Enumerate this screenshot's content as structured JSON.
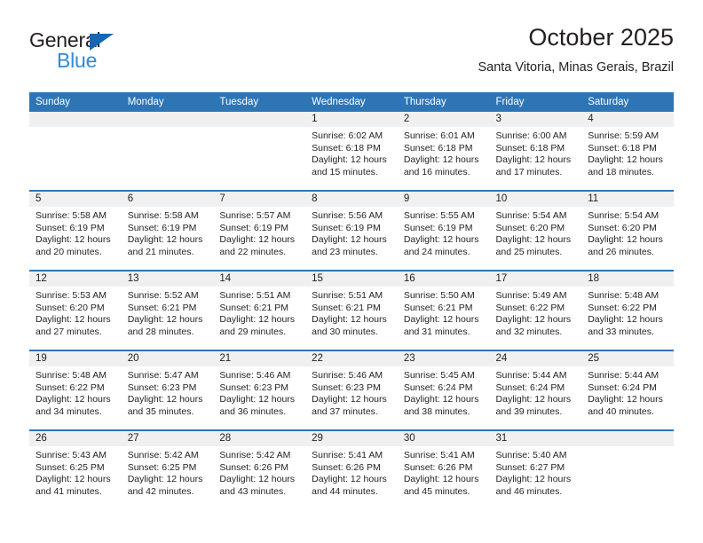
{
  "brand": {
    "name_part1": "General",
    "name_part2": "Blue",
    "triangle_icon": "triangle-icon",
    "colors": {
      "dark": "#231f20",
      "blue": "#2e8bd8",
      "triangle": "#1667b3"
    }
  },
  "header": {
    "month_title": "October 2025",
    "location": "Santa Vitoria, Minas Gerais, Brazil"
  },
  "theme": {
    "header_blue": "#2e75b6",
    "daynum_band": "#f0f0f0",
    "cell_background": "#ffffff",
    "text": "#231f20"
  },
  "calendar": {
    "weekday_headers": [
      "Sunday",
      "Monday",
      "Tuesday",
      "Wednesday",
      "Thursday",
      "Friday",
      "Saturday"
    ],
    "weeks": [
      [
        {
          "day": "",
          "empty": true,
          "sunrise": "",
          "sunset": "",
          "daylight_line1": "",
          "daylight_line2": ""
        },
        {
          "day": "",
          "empty": true,
          "sunrise": "",
          "sunset": "",
          "daylight_line1": "",
          "daylight_line2": ""
        },
        {
          "day": "",
          "empty": true,
          "sunrise": "",
          "sunset": "",
          "daylight_line1": "",
          "daylight_line2": ""
        },
        {
          "day": "1",
          "empty": false,
          "sunrise": "Sunrise: 6:02 AM",
          "sunset": "Sunset: 6:18 PM",
          "daylight_line1": "Daylight: 12 hours",
          "daylight_line2": "and 15 minutes."
        },
        {
          "day": "2",
          "empty": false,
          "sunrise": "Sunrise: 6:01 AM",
          "sunset": "Sunset: 6:18 PM",
          "daylight_line1": "Daylight: 12 hours",
          "daylight_line2": "and 16 minutes."
        },
        {
          "day": "3",
          "empty": false,
          "sunrise": "Sunrise: 6:00 AM",
          "sunset": "Sunset: 6:18 PM",
          "daylight_line1": "Daylight: 12 hours",
          "daylight_line2": "and 17 minutes."
        },
        {
          "day": "4",
          "empty": false,
          "sunrise": "Sunrise: 5:59 AM",
          "sunset": "Sunset: 6:18 PM",
          "daylight_line1": "Daylight: 12 hours",
          "daylight_line2": "and 18 minutes."
        }
      ],
      [
        {
          "day": "5",
          "empty": false,
          "sunrise": "Sunrise: 5:58 AM",
          "sunset": "Sunset: 6:19 PM",
          "daylight_line1": "Daylight: 12 hours",
          "daylight_line2": "and 20 minutes."
        },
        {
          "day": "6",
          "empty": false,
          "sunrise": "Sunrise: 5:58 AM",
          "sunset": "Sunset: 6:19 PM",
          "daylight_line1": "Daylight: 12 hours",
          "daylight_line2": "and 21 minutes."
        },
        {
          "day": "7",
          "empty": false,
          "sunrise": "Sunrise: 5:57 AM",
          "sunset": "Sunset: 6:19 PM",
          "daylight_line1": "Daylight: 12 hours",
          "daylight_line2": "and 22 minutes."
        },
        {
          "day": "8",
          "empty": false,
          "sunrise": "Sunrise: 5:56 AM",
          "sunset": "Sunset: 6:19 PM",
          "daylight_line1": "Daylight: 12 hours",
          "daylight_line2": "and 23 minutes."
        },
        {
          "day": "9",
          "empty": false,
          "sunrise": "Sunrise: 5:55 AM",
          "sunset": "Sunset: 6:19 PM",
          "daylight_line1": "Daylight: 12 hours",
          "daylight_line2": "and 24 minutes."
        },
        {
          "day": "10",
          "empty": false,
          "sunrise": "Sunrise: 5:54 AM",
          "sunset": "Sunset: 6:20 PM",
          "daylight_line1": "Daylight: 12 hours",
          "daylight_line2": "and 25 minutes."
        },
        {
          "day": "11",
          "empty": false,
          "sunrise": "Sunrise: 5:54 AM",
          "sunset": "Sunset: 6:20 PM",
          "daylight_line1": "Daylight: 12 hours",
          "daylight_line2": "and 26 minutes."
        }
      ],
      [
        {
          "day": "12",
          "empty": false,
          "sunrise": "Sunrise: 5:53 AM",
          "sunset": "Sunset: 6:20 PM",
          "daylight_line1": "Daylight: 12 hours",
          "daylight_line2": "and 27 minutes."
        },
        {
          "day": "13",
          "empty": false,
          "sunrise": "Sunrise: 5:52 AM",
          "sunset": "Sunset: 6:21 PM",
          "daylight_line1": "Daylight: 12 hours",
          "daylight_line2": "and 28 minutes."
        },
        {
          "day": "14",
          "empty": false,
          "sunrise": "Sunrise: 5:51 AM",
          "sunset": "Sunset: 6:21 PM",
          "daylight_line1": "Daylight: 12 hours",
          "daylight_line2": "and 29 minutes."
        },
        {
          "day": "15",
          "empty": false,
          "sunrise": "Sunrise: 5:51 AM",
          "sunset": "Sunset: 6:21 PM",
          "daylight_line1": "Daylight: 12 hours",
          "daylight_line2": "and 30 minutes."
        },
        {
          "day": "16",
          "empty": false,
          "sunrise": "Sunrise: 5:50 AM",
          "sunset": "Sunset: 6:21 PM",
          "daylight_line1": "Daylight: 12 hours",
          "daylight_line2": "and 31 minutes."
        },
        {
          "day": "17",
          "empty": false,
          "sunrise": "Sunrise: 5:49 AM",
          "sunset": "Sunset: 6:22 PM",
          "daylight_line1": "Daylight: 12 hours",
          "daylight_line2": "and 32 minutes."
        },
        {
          "day": "18",
          "empty": false,
          "sunrise": "Sunrise: 5:48 AM",
          "sunset": "Sunset: 6:22 PM",
          "daylight_line1": "Daylight: 12 hours",
          "daylight_line2": "and 33 minutes."
        }
      ],
      [
        {
          "day": "19",
          "empty": false,
          "sunrise": "Sunrise: 5:48 AM",
          "sunset": "Sunset: 6:22 PM",
          "daylight_line1": "Daylight: 12 hours",
          "daylight_line2": "and 34 minutes."
        },
        {
          "day": "20",
          "empty": false,
          "sunrise": "Sunrise: 5:47 AM",
          "sunset": "Sunset: 6:23 PM",
          "daylight_line1": "Daylight: 12 hours",
          "daylight_line2": "and 35 minutes."
        },
        {
          "day": "21",
          "empty": false,
          "sunrise": "Sunrise: 5:46 AM",
          "sunset": "Sunset: 6:23 PM",
          "daylight_line1": "Daylight: 12 hours",
          "daylight_line2": "and 36 minutes."
        },
        {
          "day": "22",
          "empty": false,
          "sunrise": "Sunrise: 5:46 AM",
          "sunset": "Sunset: 6:23 PM",
          "daylight_line1": "Daylight: 12 hours",
          "daylight_line2": "and 37 minutes."
        },
        {
          "day": "23",
          "empty": false,
          "sunrise": "Sunrise: 5:45 AM",
          "sunset": "Sunset: 6:24 PM",
          "daylight_line1": "Daylight: 12 hours",
          "daylight_line2": "and 38 minutes."
        },
        {
          "day": "24",
          "empty": false,
          "sunrise": "Sunrise: 5:44 AM",
          "sunset": "Sunset: 6:24 PM",
          "daylight_line1": "Daylight: 12 hours",
          "daylight_line2": "and 39 minutes."
        },
        {
          "day": "25",
          "empty": false,
          "sunrise": "Sunrise: 5:44 AM",
          "sunset": "Sunset: 6:24 PM",
          "daylight_line1": "Daylight: 12 hours",
          "daylight_line2": "and 40 minutes."
        }
      ],
      [
        {
          "day": "26",
          "empty": false,
          "sunrise": "Sunrise: 5:43 AM",
          "sunset": "Sunset: 6:25 PM",
          "daylight_line1": "Daylight: 12 hours",
          "daylight_line2": "and 41 minutes."
        },
        {
          "day": "27",
          "empty": false,
          "sunrise": "Sunrise: 5:42 AM",
          "sunset": "Sunset: 6:25 PM",
          "daylight_line1": "Daylight: 12 hours",
          "daylight_line2": "and 42 minutes."
        },
        {
          "day": "28",
          "empty": false,
          "sunrise": "Sunrise: 5:42 AM",
          "sunset": "Sunset: 6:26 PM",
          "daylight_line1": "Daylight: 12 hours",
          "daylight_line2": "and 43 minutes."
        },
        {
          "day": "29",
          "empty": false,
          "sunrise": "Sunrise: 5:41 AM",
          "sunset": "Sunset: 6:26 PM",
          "daylight_line1": "Daylight: 12 hours",
          "daylight_line2": "and 44 minutes."
        },
        {
          "day": "30",
          "empty": false,
          "sunrise": "Sunrise: 5:41 AM",
          "sunset": "Sunset: 6:26 PM",
          "daylight_line1": "Daylight: 12 hours",
          "daylight_line2": "and 45 minutes."
        },
        {
          "day": "31",
          "empty": false,
          "sunrise": "Sunrise: 5:40 AM",
          "sunset": "Sunset: 6:27 PM",
          "daylight_line1": "Daylight: 12 hours",
          "daylight_line2": "and 46 minutes."
        },
        {
          "day": "",
          "empty": true,
          "sunrise": "",
          "sunset": "",
          "daylight_line1": "",
          "daylight_line2": ""
        }
      ]
    ]
  }
}
